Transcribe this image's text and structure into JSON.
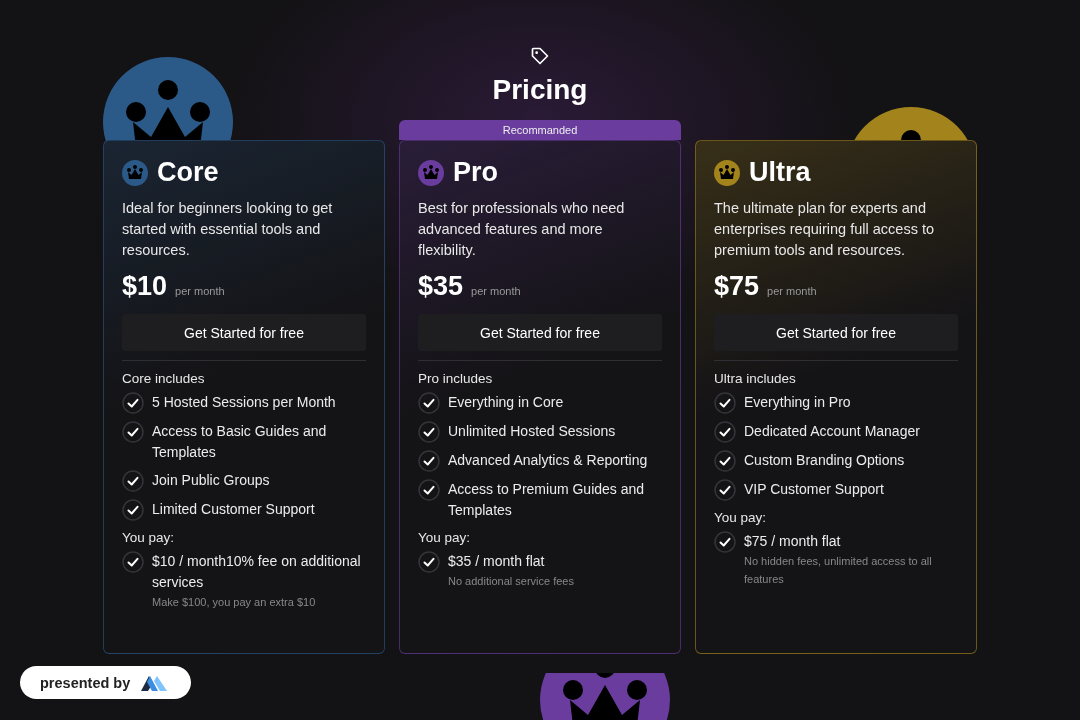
{
  "header": {
    "title": "Pricing"
  },
  "plans": [
    {
      "name": "Core",
      "color": "#2c5a88",
      "description": "Ideal for beginners looking to get started with essential tools and resources.",
      "price": "$10",
      "period": "per month",
      "button": "Get Started for free",
      "includes_title": "Core includes",
      "features": [
        "5 Hosted Sessions per Month",
        "Access to Basic Guides and Templates",
        "Join Public Groups",
        "Limited Customer Support"
      ],
      "pay_title": "You pay:",
      "pay_item": "$10 / month10% fee on additional services",
      "pay_note": "Make $100, you pay an extra $10"
    },
    {
      "name": "Pro",
      "color": "#6a3c9e",
      "badge": "Recommanded",
      "description": "Best for professionals who need advanced features and more flexibility.",
      "price": "$35",
      "period": "per month",
      "button": "Get Started for free",
      "includes_title": "Pro includes",
      "features": [
        "Everything in Core",
        "Unlimited Hosted Sessions",
        "Advanced Analytics & Reporting",
        "Access to Premium Guides and Templates"
      ],
      "pay_title": "You pay:",
      "pay_item": "$35 / month flat",
      "pay_note": "No additional service fees"
    },
    {
      "name": "Ultra",
      "color": "#a3841c",
      "description": "The ultimate plan for experts and enterprises requiring full access to premium tools and resources.",
      "price": "$75",
      "period": "per month",
      "button": "Get Started for free",
      "includes_title": "Ultra includes",
      "features": [
        "Everything in Pro",
        "Dedicated Account Manager",
        "Custom Branding Options",
        "VIP Customer Support"
      ],
      "pay_title": "You pay:",
      "pay_item": "$75 / month flat",
      "pay_note": "No hidden fees, unlimited access to all features"
    }
  ],
  "presented_by": {
    "label": "presented by"
  }
}
